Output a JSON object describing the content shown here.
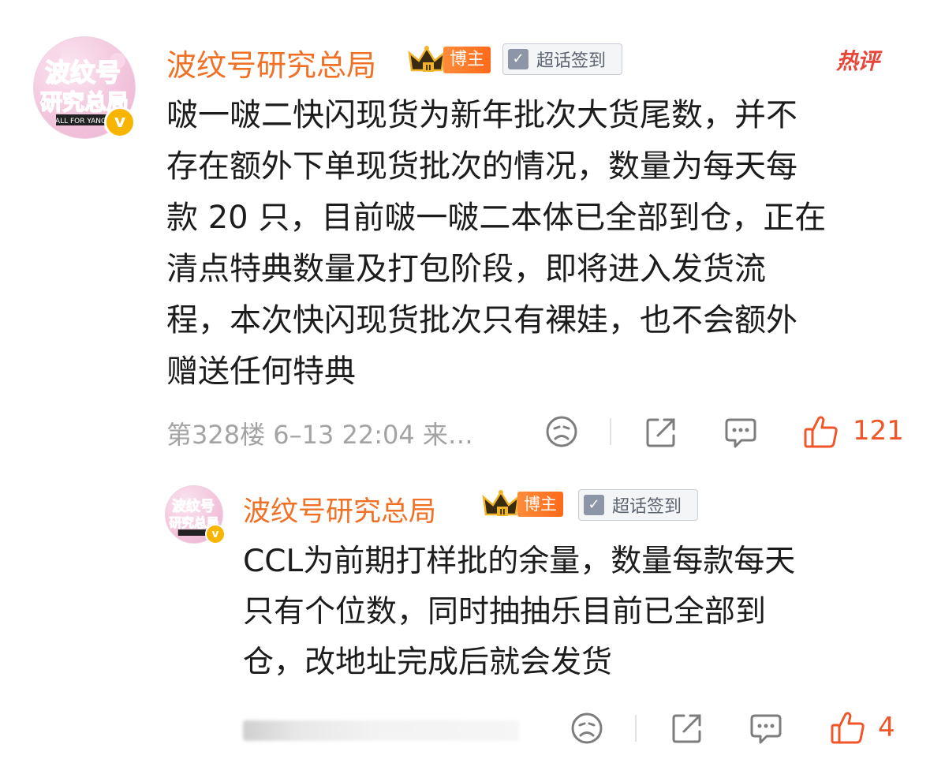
{
  "comment": {
    "username": "波纹号研究总局",
    "badge_bozhu": "博主",
    "badge_chaohua": "超话签到",
    "hot_label": "热评",
    "avatar_text": [
      "波纹号",
      "研究总局"
    ],
    "avatar_sub": "ALL FOR YANGBO",
    "content_lines": [
      "啵一啵二快闪现货为新年批次大货尾数，并不",
      "存在额外下单现货批次的情况，数量为每天每",
      "款 20 只，目前啵一啵二本体已全部到仓，正在",
      "清点特典数量及打包阶段，即将进入发货流",
      "程，本次快闪现货批次只有裸娃，也不会额外",
      "赠送任何特典"
    ],
    "meta": "第328楼 6–13 22:04 来…",
    "likes": "121",
    "icons": [
      "sad-face-icon",
      "share-icon",
      "comment-icon",
      "like-thumb-icon"
    ]
  },
  "reply": {
    "username": "波纹号研究总局",
    "badge_bozhu": "博主",
    "badge_chaohua": "超话签到",
    "avatar_text": [
      "波纹号",
      "研究总局"
    ],
    "content_lines": [
      "CCL为前期打样批的余量，数量每款每天",
      "只有个位数，同时抽抽乐目前已全部到",
      "仓，改地址完成后就会发货"
    ],
    "likes": "4",
    "icons": [
      "sad-face-icon",
      "share-icon",
      "comment-icon",
      "like-thumb-icon"
    ]
  },
  "colors": {
    "username": "#f07025",
    "like": "#f0562a",
    "hot": "#e8463b",
    "meta": "#a3a3a3",
    "icon": "#7d7d7d"
  }
}
